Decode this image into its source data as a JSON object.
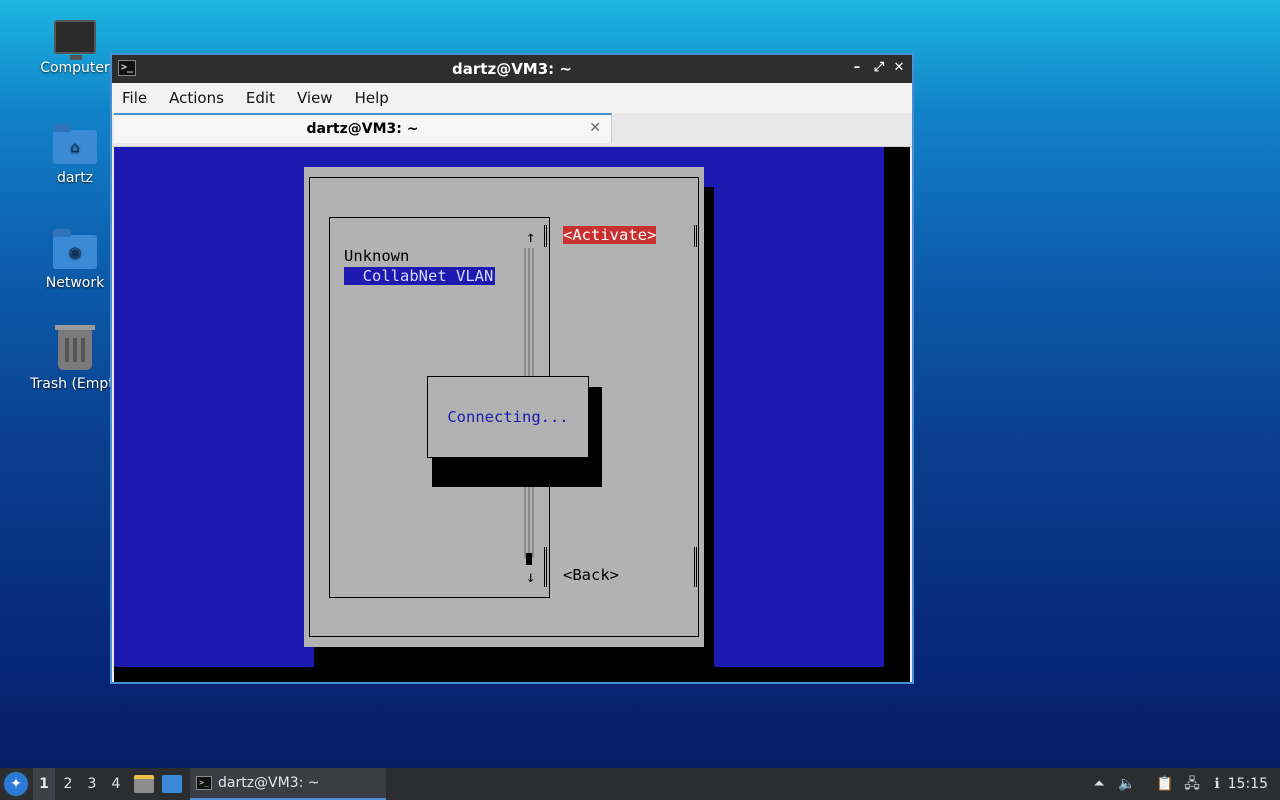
{
  "desktop": {
    "icons": [
      {
        "label": "Computer",
        "icon": "computer-icon"
      },
      {
        "label": "dartz",
        "icon": "home-folder-icon"
      },
      {
        "label": "Network",
        "icon": "network-folder-icon"
      },
      {
        "label": "Trash (Empty)",
        "icon": "trash-icon"
      }
    ]
  },
  "window": {
    "title": "dartz@VM3: ~",
    "controls": {
      "minimize": "–",
      "maximize": "⤢",
      "close": "✕"
    },
    "menu": [
      "File",
      "Actions",
      "Edit",
      "View",
      "Help"
    ],
    "tab": {
      "title": "dartz@VM3: ~",
      "close": "✕"
    }
  },
  "tui": {
    "list_items": [
      "Unknown",
      "  CollabNet VLAN"
    ],
    "selected_index": 1,
    "scroll_up": "↑",
    "scroll_down": "↓",
    "buttons": {
      "activate": "<Activate>",
      "back": "<Back>"
    },
    "popup_text": "Connecting..."
  },
  "taskbar": {
    "workspaces": [
      "1",
      "2",
      "3",
      "4"
    ],
    "active_workspace": "1",
    "task_label": "dartz@VM3: ~",
    "clock": "15:15"
  },
  "colors": {
    "tui_background": "#1c1ab0",
    "dialog": "#b2b2b2",
    "focus_button": "#c93030",
    "accent": "#4a8fd6"
  }
}
